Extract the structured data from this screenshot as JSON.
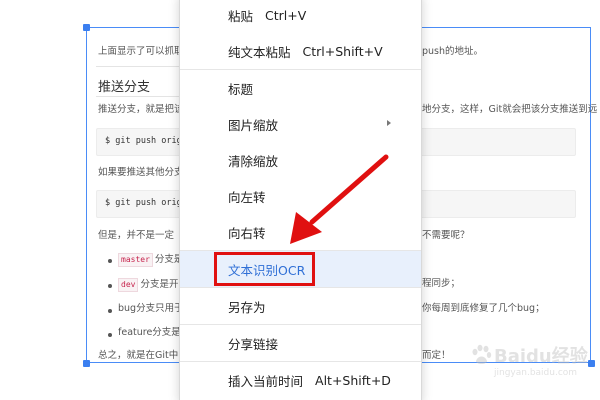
{
  "document": {
    "line_intro": "上面显示了可以抓取",
    "line_intro_right": "push的地址。",
    "heading_push": "推送分支",
    "line_push_left": "推送分支，就是把该",
    "line_push_right": "地分支，这样，Git就会把该分支推送到远",
    "code_1": "$ git push origin",
    "line_other_left": "如果要推送其他分支",
    "code_2": "$ git push origin",
    "line_but_left": "但是，并不是一定",
    "line_but_right": "不需要呢？",
    "bullet_1_tag": "master",
    "bullet_1_text": "分支是",
    "bullet_2_tag": "dev",
    "bullet_2_text": "分支是开",
    "bullet_2_right": "程同步；",
    "bullet_3_text": "bug分支只用于",
    "bullet_3_right": "你每周到底修复了几个bug；",
    "bullet_4_text": "feature分支是",
    "line_summary_left": "总之，就是在Git中",
    "line_summary_right": "而定！"
  },
  "menu": {
    "items": [
      {
        "label": "粘贴",
        "shortcut": "Ctrl+V"
      },
      {
        "label": "纯文本粘贴",
        "shortcut": "Ctrl+Shift+V"
      },
      {
        "label": "标题",
        "shortcut": ""
      },
      {
        "label": "图片缩放",
        "shortcut": ""
      },
      {
        "label": "清除缩放",
        "shortcut": ""
      },
      {
        "label": "向左转",
        "shortcut": ""
      },
      {
        "label": "向右转",
        "shortcut": ""
      },
      {
        "label": "文本识别OCR",
        "shortcut": ""
      },
      {
        "label": "另存为",
        "shortcut": ""
      },
      {
        "label": "分享链接",
        "shortcut": ""
      },
      {
        "label": "插入当前时间",
        "shortcut": "Alt+Shift+D"
      }
    ]
  },
  "watermark": {
    "brand": "Baidu经验",
    "url": "jingyan.baidu.com"
  },
  "colors": {
    "highlight_bg": "#e8f0fc",
    "highlight_text": "#2f6fd6",
    "annotation_red": "#e01010",
    "selection_blue": "#4a8cf7"
  }
}
